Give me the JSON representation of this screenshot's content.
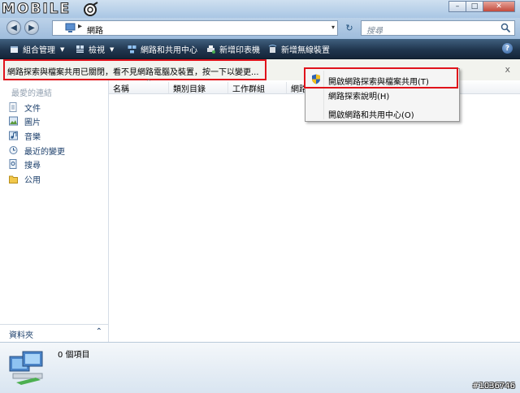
{
  "window": {
    "logo_text": "MOBILE",
    "minimize_glyph": "–",
    "maximize_glyph": "□",
    "close_glyph": "✕"
  },
  "address": {
    "back_glyph": "◀",
    "forward_glyph": "▶",
    "separator": "▸",
    "location": "網路",
    "dropdown_glyph": "▾",
    "refresh_glyph": "↻",
    "search_placeholder": "搜尋"
  },
  "toolbar": {
    "organize_label": "組合管理",
    "views_label": "檢視",
    "network_center_label": "網路和共用中心",
    "add_printer_label": "新增印表機",
    "add_wireless_label": "新增無線裝置",
    "dropdown_glyph": "▼",
    "help_glyph": "?"
  },
  "infobar": {
    "message": "網路探索與檔案共用已關閉，看不見網路電腦及裝置，按一下以變更...",
    "close_glyph": "x"
  },
  "context_menu": {
    "items": [
      {
        "label": "開啟網路探索與檔案共用(T)"
      },
      {
        "label": "網路探索說明(H)"
      },
      {
        "label": "開啟網路和共用中心(O)"
      }
    ]
  },
  "nav": {
    "title": "最愛的連結",
    "items": [
      {
        "label": "文件",
        "icon": "documents-icon"
      },
      {
        "label": "圖片",
        "icon": "pictures-icon"
      },
      {
        "label": "音樂",
        "icon": "music-icon"
      },
      {
        "label": "最近的變更",
        "icon": "recent-changes-icon"
      },
      {
        "label": "搜尋",
        "icon": "search-folder-icon"
      },
      {
        "label": "公用",
        "icon": "public-folder-icon"
      }
    ],
    "folders_label": "資料夾",
    "folders_chevron": "⌃"
  },
  "columns": {
    "sort_caret": "^",
    "headers": [
      "名稱",
      "類別目錄",
      "工作群組",
      "網路"
    ]
  },
  "details": {
    "item_count": "0 個項目"
  },
  "watermark": "#1036746",
  "colors": {
    "highlight_red": "#e0131b",
    "toolbar_bg": "#20364f",
    "nav_link": "#1c3f6b"
  }
}
